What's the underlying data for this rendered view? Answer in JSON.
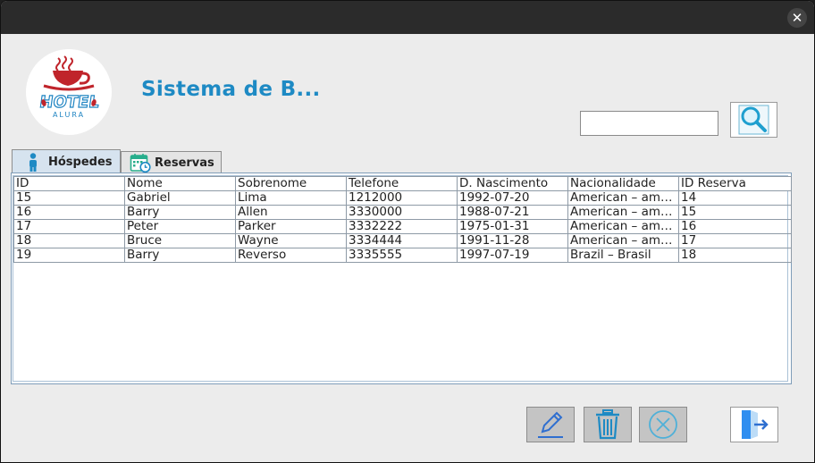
{
  "window": {
    "close_label": "✕"
  },
  "header": {
    "title": "Sistema de B...",
    "logo_text_main": "HOTEL",
    "logo_text_sub": "ALURA"
  },
  "search": {
    "value": "",
    "placeholder": ""
  },
  "tabs": [
    {
      "label": "Hóspedes",
      "icon": "person-icon",
      "active": true
    },
    {
      "label": "Reservas",
      "icon": "calendar-icon",
      "active": false
    }
  ],
  "table": {
    "columns": [
      "ID",
      "Nome",
      "Sobrenome",
      "Telefone",
      "D. Nascimento",
      "Nacionalidade",
      "ID Reserva"
    ],
    "rows": [
      [
        "15",
        "Gabriel",
        "Lima",
        "1212000",
        "1992-07-20",
        "American – ame...",
        "14"
      ],
      [
        "16",
        "Barry",
        "Allen",
        "3330000",
        "1988-07-21",
        "American – ame...",
        "15"
      ],
      [
        "17",
        "Peter",
        "Parker",
        "3332222",
        "1975-01-31",
        "American – ame...",
        "16"
      ],
      [
        "18",
        "Bruce",
        "Wayne",
        "3334444",
        "1991-11-28",
        "American – ame...",
        "17"
      ],
      [
        "19",
        "Barry",
        "Reverso",
        "3335555",
        "1997-07-19",
        "Brazil – Brasil",
        "18"
      ]
    ]
  },
  "actions": [
    {
      "name": "edit-button",
      "icon": "pencil-icon"
    },
    {
      "name": "delete-button",
      "icon": "trash-icon"
    },
    {
      "name": "cancel-button",
      "icon": "cancel-circle-icon"
    },
    {
      "name": "exit-button",
      "icon": "exit-door-icon"
    }
  ],
  "colors": {
    "title": "#1e8ac4",
    "titlebar": "#2b2b2b",
    "logo_red": "#c0242b",
    "logo_blue": "#1f84c2",
    "active_tab": "#d6e3ef",
    "action_button": "#c4c4c4"
  }
}
